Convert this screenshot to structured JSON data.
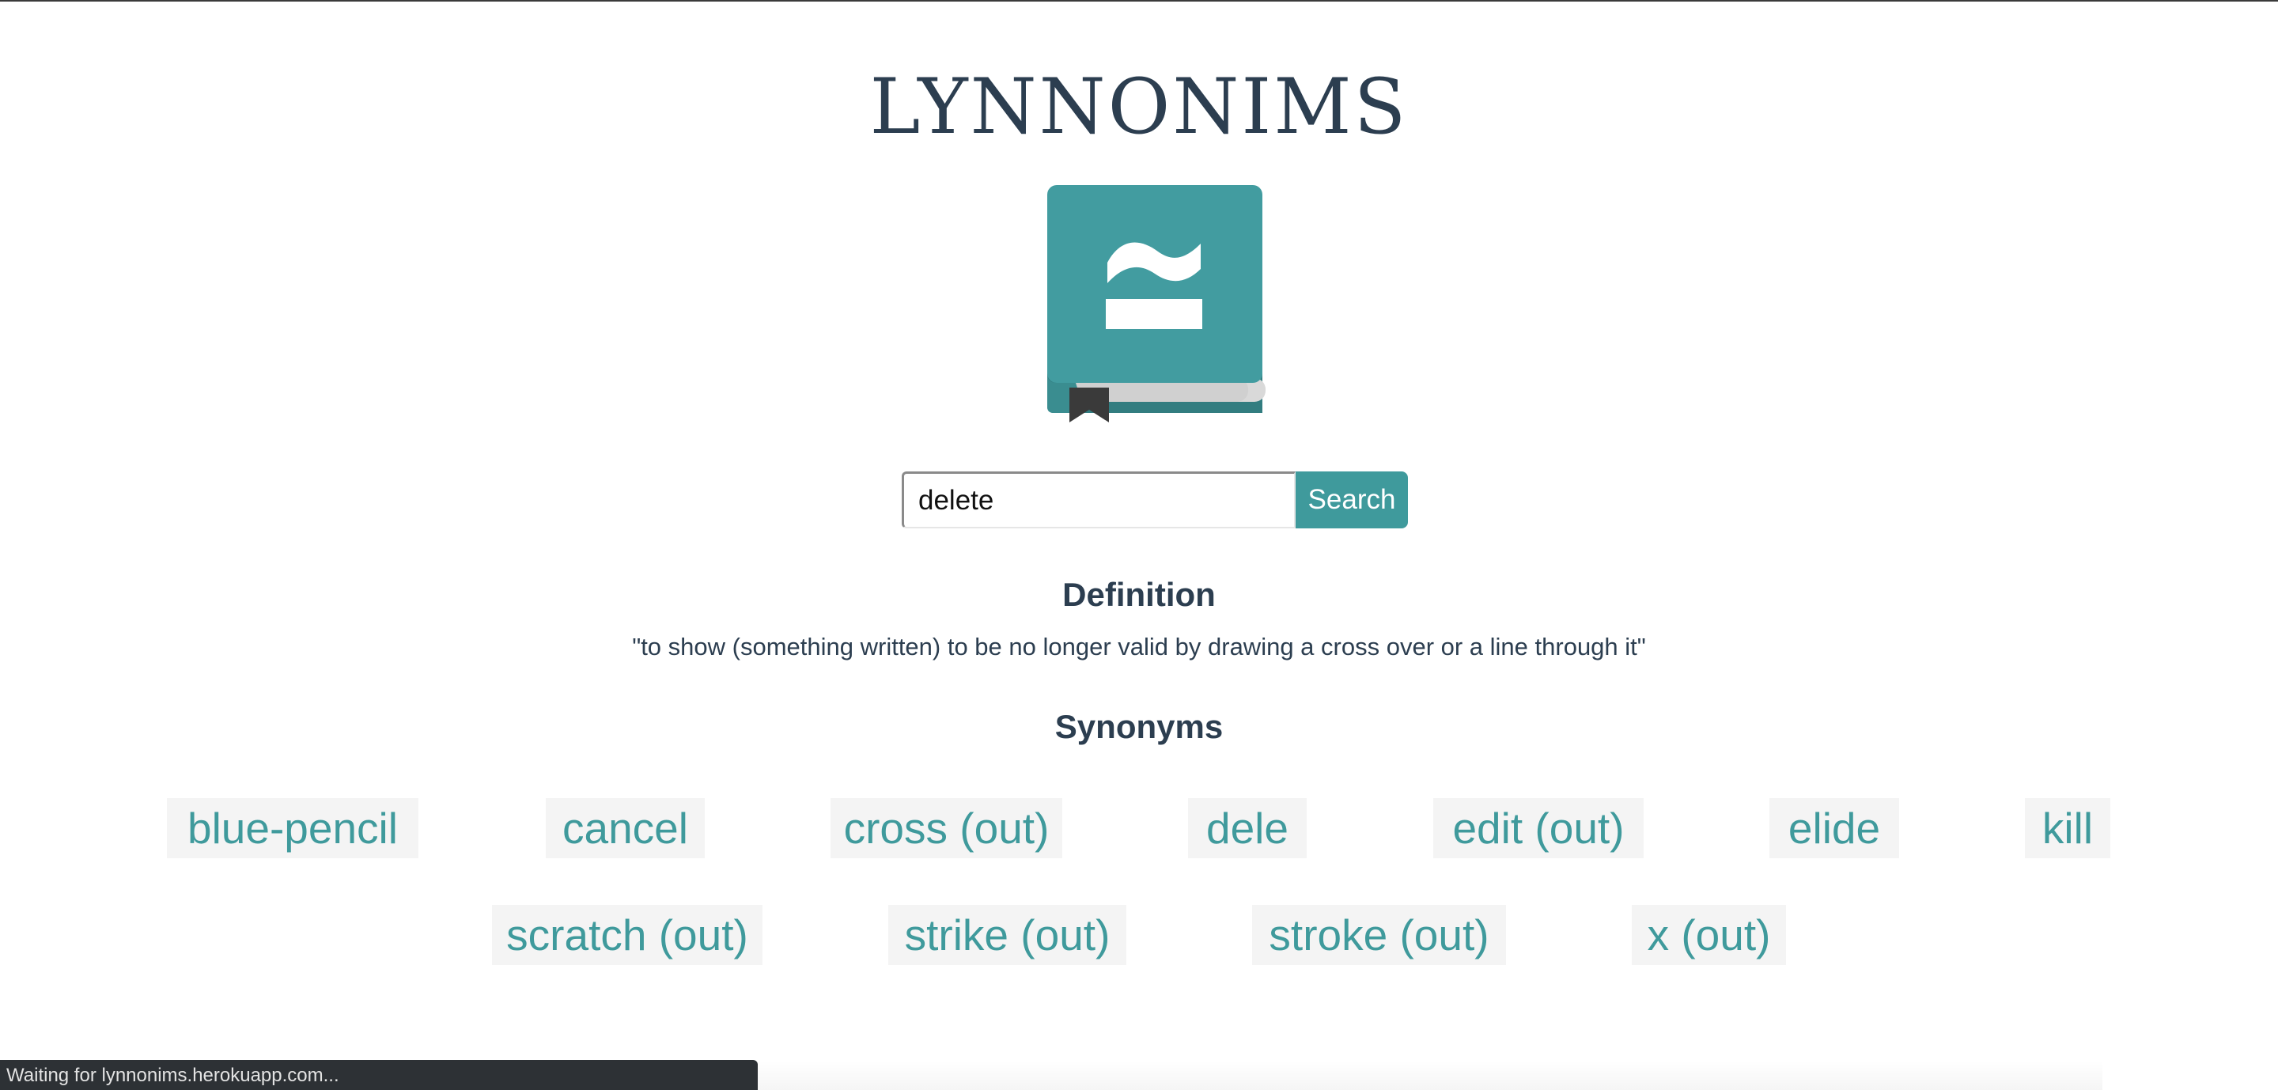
{
  "app": {
    "title": "LYNNONIMS"
  },
  "logo": {
    "icon": "book-approx-icon",
    "colors": {
      "cover": "#429ca0",
      "cover_dark": "#327d80",
      "pages": "#d9d9d9",
      "bookmark": "#3a3a3a",
      "symbol": "#ffffff"
    }
  },
  "search": {
    "value": "delete",
    "button_label": "Search"
  },
  "definition": {
    "heading": "Definition",
    "text": "\"to show (something written) to be no longer valid by drawing a cross over or a line through it\""
  },
  "synonyms": {
    "heading": "Synonyms",
    "items": [
      "blue-pencil",
      "cancel",
      "cross (out)",
      "dele",
      "edit (out)",
      "elide",
      "kill",
      "scratch (out)",
      "strike (out)",
      "stroke (out)",
      "x (out)"
    ]
  },
  "status_bar": {
    "text": "Waiting for lynnonims.herokuapp.com..."
  },
  "colors": {
    "accent": "#3f9a9c",
    "text_dark": "#2c3e50",
    "chip_background": "#f4f4f4"
  }
}
